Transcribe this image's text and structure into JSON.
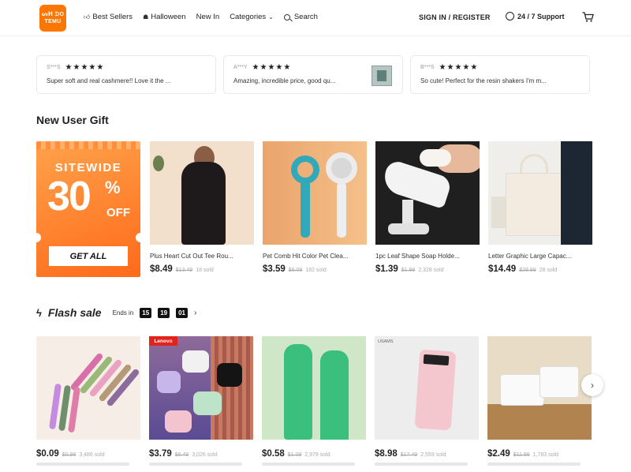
{
  "header": {
    "logo_line1": "ᔕᕼ ᗪO",
    "logo_line2": "TEMU",
    "nav": [
      {
        "label": "Best Sellers",
        "icon": "thumbs-up-icon"
      },
      {
        "label": "Halloween",
        "icon": "ghost-icon"
      },
      {
        "label": "New In"
      },
      {
        "label": "Categories",
        "icon": "chevron-down-icon"
      },
      {
        "label": "Search",
        "icon": "search-icon"
      }
    ],
    "signin": "SIGN IN / REGISTER",
    "support": "24 / 7 Support"
  },
  "reviews": [
    {
      "user": "S***S",
      "stars": "★★★★★",
      "text": "Super soft and real cashmere!! Love it the ..."
    },
    {
      "user": "A***Y",
      "stars": "★★★★★",
      "text": "Amazing, incredible price, good qu..."
    },
    {
      "user": "B***S",
      "stars": "★★★★★",
      "text": "So cute! Perfect for the resin shakers I'm m..."
    }
  ],
  "new_user": {
    "title": "New User Gift",
    "promo": {
      "sitewide": "SITEWIDE",
      "percent": "30",
      "percent_sign": "%",
      "off": "OFF",
      "button": "GET ALL"
    },
    "products": [
      {
        "name": "Plus Heart Cut Out Tee Rou...",
        "price": "$8.49",
        "old": "$13.49",
        "sold": "18 sold"
      },
      {
        "name": "Pet Comb Hit Color Pet Clea...",
        "price": "$3.59",
        "old": "$6.09",
        "sold": "182 sold"
      },
      {
        "name": "1pc Leaf Shape Soap Holde...",
        "price": "$1.39",
        "old": "$1.99",
        "sold": "2,328 sold"
      },
      {
        "name": "Letter Graphic Large Capac...",
        "price": "$14.49",
        "old": "$29.99",
        "sold": "28 sold"
      }
    ]
  },
  "flash_sale": {
    "title": "Flash sale",
    "ends_label": "Ends in",
    "timer": [
      "15",
      "19",
      "01"
    ],
    "products": [
      {
        "price": "$0.09",
        "old": "$0.98",
        "sold": "3,486 sold"
      },
      {
        "price": "$3.79",
        "old": "$6.49",
        "sold": "3,026 sold",
        "brand": "Lenovo"
      },
      {
        "price": "$0.58",
        "old": "$1.09",
        "sold": "2,979 sold"
      },
      {
        "price": "$8.98",
        "old": "$17.49",
        "sold": "2,559 sold",
        "brand": "USAMS"
      },
      {
        "price": "$2.49",
        "old": "$11.99",
        "sold": "1,783 sold"
      }
    ]
  },
  "colors": {
    "brand": "#fb7701",
    "promo": "#ff7a22"
  }
}
